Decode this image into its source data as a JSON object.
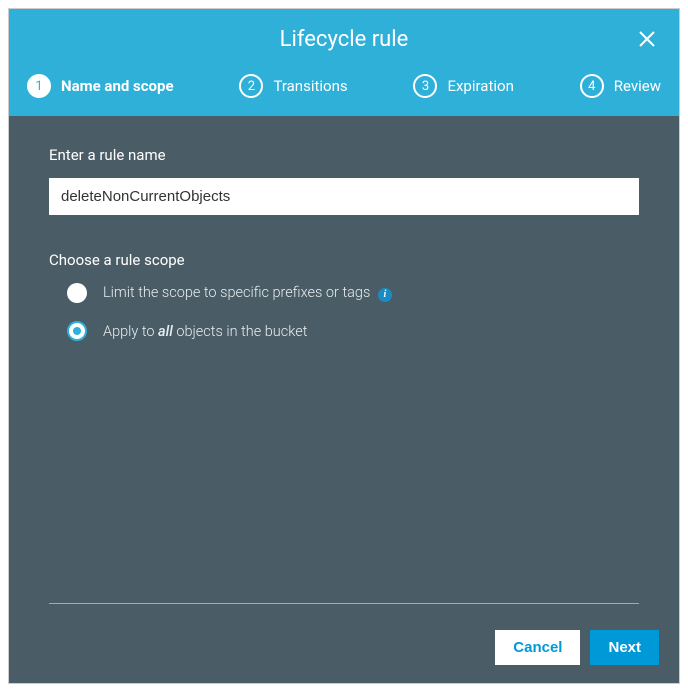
{
  "modal": {
    "title": "Lifecycle rule",
    "steps": [
      {
        "num": "1",
        "label": "Name and scope",
        "active": true
      },
      {
        "num": "2",
        "label": "Transitions",
        "active": false
      },
      {
        "num": "3",
        "label": "Expiration",
        "active": false
      },
      {
        "num": "4",
        "label": "Review",
        "active": false
      }
    ]
  },
  "form": {
    "name_label": "Enter a rule name",
    "name_value": "deleteNonCurrentObjects",
    "scope_label": "Choose a rule scope",
    "scope_options": {
      "limit_prefix": "Limit the scope to specific prefixes or tags",
      "apply_all_pre": "Apply to ",
      "apply_all_em": "all",
      "apply_all_post": " objects in the bucket"
    },
    "selected_scope": "all"
  },
  "footer": {
    "cancel": "Cancel",
    "next": "Next"
  }
}
